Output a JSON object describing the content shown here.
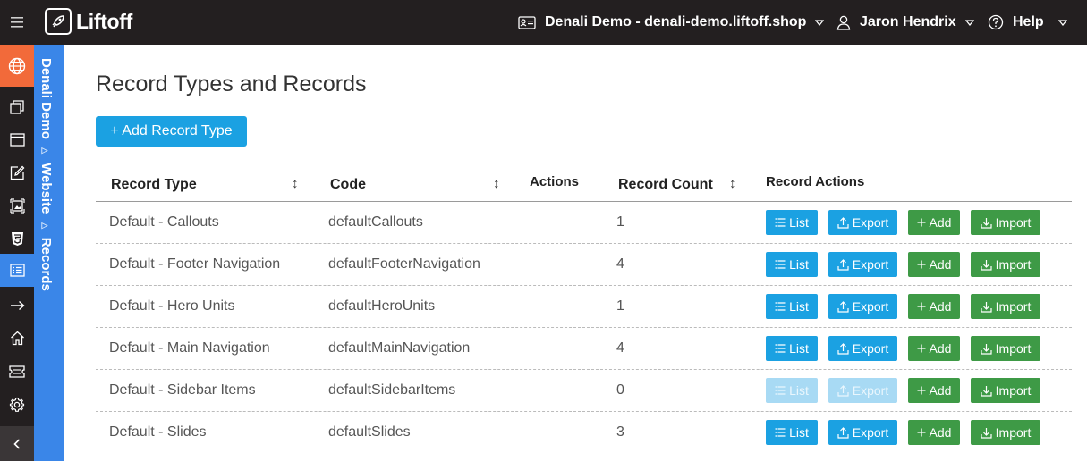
{
  "app": {
    "name": "Liftoff"
  },
  "header": {
    "site_selector": "Denali Demo - denali-demo.liftoff.shop",
    "user_name": "Jaron Hendrix",
    "help_label": "Help"
  },
  "breadcrumb": {
    "items": [
      "Denali Demo",
      "Website",
      "Records"
    ]
  },
  "page": {
    "title": "Record Types and Records",
    "add_button_label": "+ Add Record Type"
  },
  "table": {
    "headers": {
      "record_type": "Record Type",
      "code": "Code",
      "actions": "Actions",
      "record_count": "Record Count",
      "record_actions": "Record Actions"
    },
    "action_labels": {
      "list": "List",
      "export": "Export",
      "add": "Add",
      "import": "Import"
    },
    "rows": [
      {
        "type": "Default - Callouts",
        "code": "defaultCallouts",
        "count": "1",
        "list_enabled": true,
        "export_enabled": true
      },
      {
        "type": "Default - Footer Navigation",
        "code": "defaultFooterNavigation",
        "count": "4",
        "list_enabled": true,
        "export_enabled": true
      },
      {
        "type": "Default - Hero Units",
        "code": "defaultHeroUnits",
        "count": "1",
        "list_enabled": true,
        "export_enabled": true
      },
      {
        "type": "Default - Main Navigation",
        "code": "defaultMainNavigation",
        "count": "4",
        "list_enabled": true,
        "export_enabled": true
      },
      {
        "type": "Default - Sidebar Items",
        "code": "defaultSidebarItems",
        "count": "0",
        "list_enabled": false,
        "export_enabled": false
      },
      {
        "type": "Default - Slides",
        "code": "defaultSlides",
        "count": "3",
        "list_enabled": true,
        "export_enabled": true
      }
    ]
  },
  "colors": {
    "topbar": "#231f20",
    "accent_blue": "#1ba1e2",
    "rail_active": "#3a86e8",
    "globe_orange": "#f26a3a",
    "green": "#3e9a46"
  },
  "icons": {
    "rail": [
      "globe-icon",
      "pages-icon",
      "window-icon",
      "edit-icon",
      "image-icon",
      "css-icon",
      "records-icon",
      "arrow-right-icon",
      "home-icon",
      "ticket-icon",
      "gear-icon",
      "collapse-icon"
    ]
  }
}
